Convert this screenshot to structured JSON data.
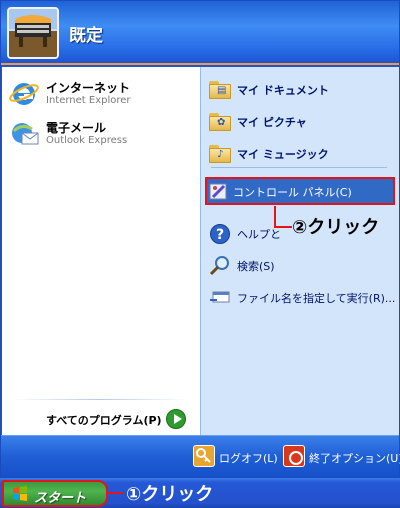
{
  "header": {
    "username": "既定"
  },
  "left": {
    "pinned": [
      {
        "title": "インターネット",
        "subtitle": "Internet Explorer",
        "icon": "internet-explorer-icon"
      },
      {
        "title": "電子メール",
        "subtitle": "Outlook Express",
        "icon": "outlook-express-icon"
      }
    ],
    "all_programs": "すべてのプログラム(P)"
  },
  "right": {
    "items": [
      {
        "label": "マイ ドキュメント",
        "icon": "my-documents-folder-icon"
      },
      {
        "label": "マイ ピクチャ",
        "icon": "my-pictures-folder-icon"
      },
      {
        "label": "マイ ミュージック",
        "icon": "my-music-folder-icon"
      },
      {
        "label": "コントロール パネル(C)",
        "icon": "control-panel-icon"
      },
      {
        "label": "ヘルプと",
        "icon": "help-icon"
      },
      {
        "label": "検索(S)",
        "icon": "search-icon"
      },
      {
        "label": "ファイル名を指定して実行(R)...",
        "icon": "run-icon"
      }
    ]
  },
  "bottom": {
    "logoff": "ログオフ(L)",
    "shutdown": "終了オプション(U)"
  },
  "taskbar": {
    "start": "スタート"
  },
  "annotations": {
    "step1": "①クリック",
    "step2": "②クリック"
  },
  "colors": {
    "highlight": "#316ac5",
    "annotation_red": "#e3141a",
    "right_panel": "#d3e5fa"
  }
}
